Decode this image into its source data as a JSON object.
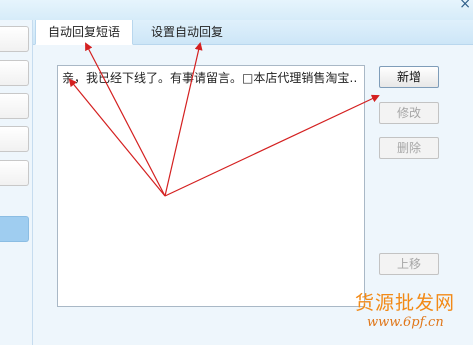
{
  "tabs": [
    {
      "label": "自动回复短语"
    },
    {
      "label": "设置自动回复"
    }
  ],
  "phrase_list": {
    "items": [
      "亲，我已经下线了。有事请留言。□本店代理销售淘宝…"
    ]
  },
  "buttons": {
    "add": "新增",
    "edit": "修改",
    "delete": "删除",
    "move_up": "上移"
  },
  "watermark": {
    "title": "货源批发网",
    "url": "www.6pf.cn"
  },
  "colors": {
    "arrow": "#d42020",
    "accent": "#9fcdf0",
    "watermark": "#f28a17"
  }
}
